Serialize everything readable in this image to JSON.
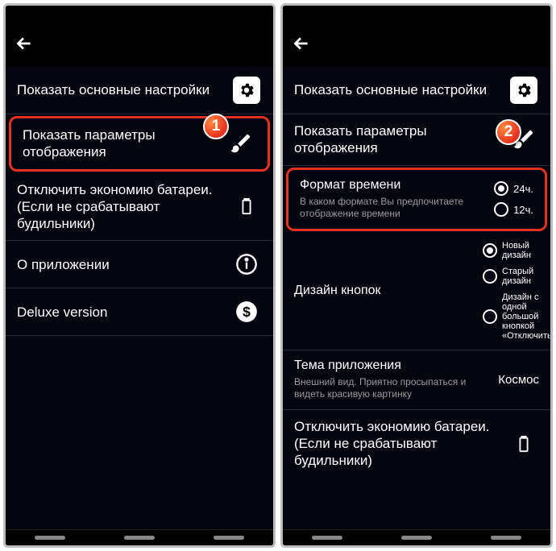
{
  "left": {
    "items": [
      {
        "label": "Показать основные настройки",
        "icon": "gear"
      },
      {
        "label": "Показать параметры отображения",
        "icon": "brush",
        "highlight": true
      },
      {
        "label": "Отключить экономию батареи. (Если не срабатывают будильники)",
        "icon": "battery"
      },
      {
        "label": "О приложении",
        "icon": "info"
      },
      {
        "label": "Deluxe version",
        "icon": "dollar"
      }
    ]
  },
  "right": {
    "top": [
      {
        "label": "Показать основные настройки",
        "icon": "gear"
      },
      {
        "label": "Показать параметры отображения",
        "icon": "brush"
      }
    ],
    "timeFormat": {
      "title": "Формат времени",
      "subtitle": "В каком формате Вы предпочитаете отображение времени",
      "options": [
        "24ч.",
        "12ч."
      ],
      "selected": "24ч."
    },
    "buttonDesign": {
      "title": "Дизайн кнопок",
      "options": [
        "Новый дизайн",
        "Старый дизайн",
        "Дизайн с одной большой кнопкой «Отключить»"
      ],
      "selected": "Новый дизайн"
    },
    "theme": {
      "title": "Тема приложения",
      "subtitle": "Внешний вид. Приятно просыпаться и видеть красивую картинку",
      "value": "Космос"
    },
    "batteryRow": {
      "label": "Отключить экономию батареи. (Если не срабатывают будильники)"
    }
  },
  "badges": {
    "b1": "1",
    "b2": "2"
  }
}
